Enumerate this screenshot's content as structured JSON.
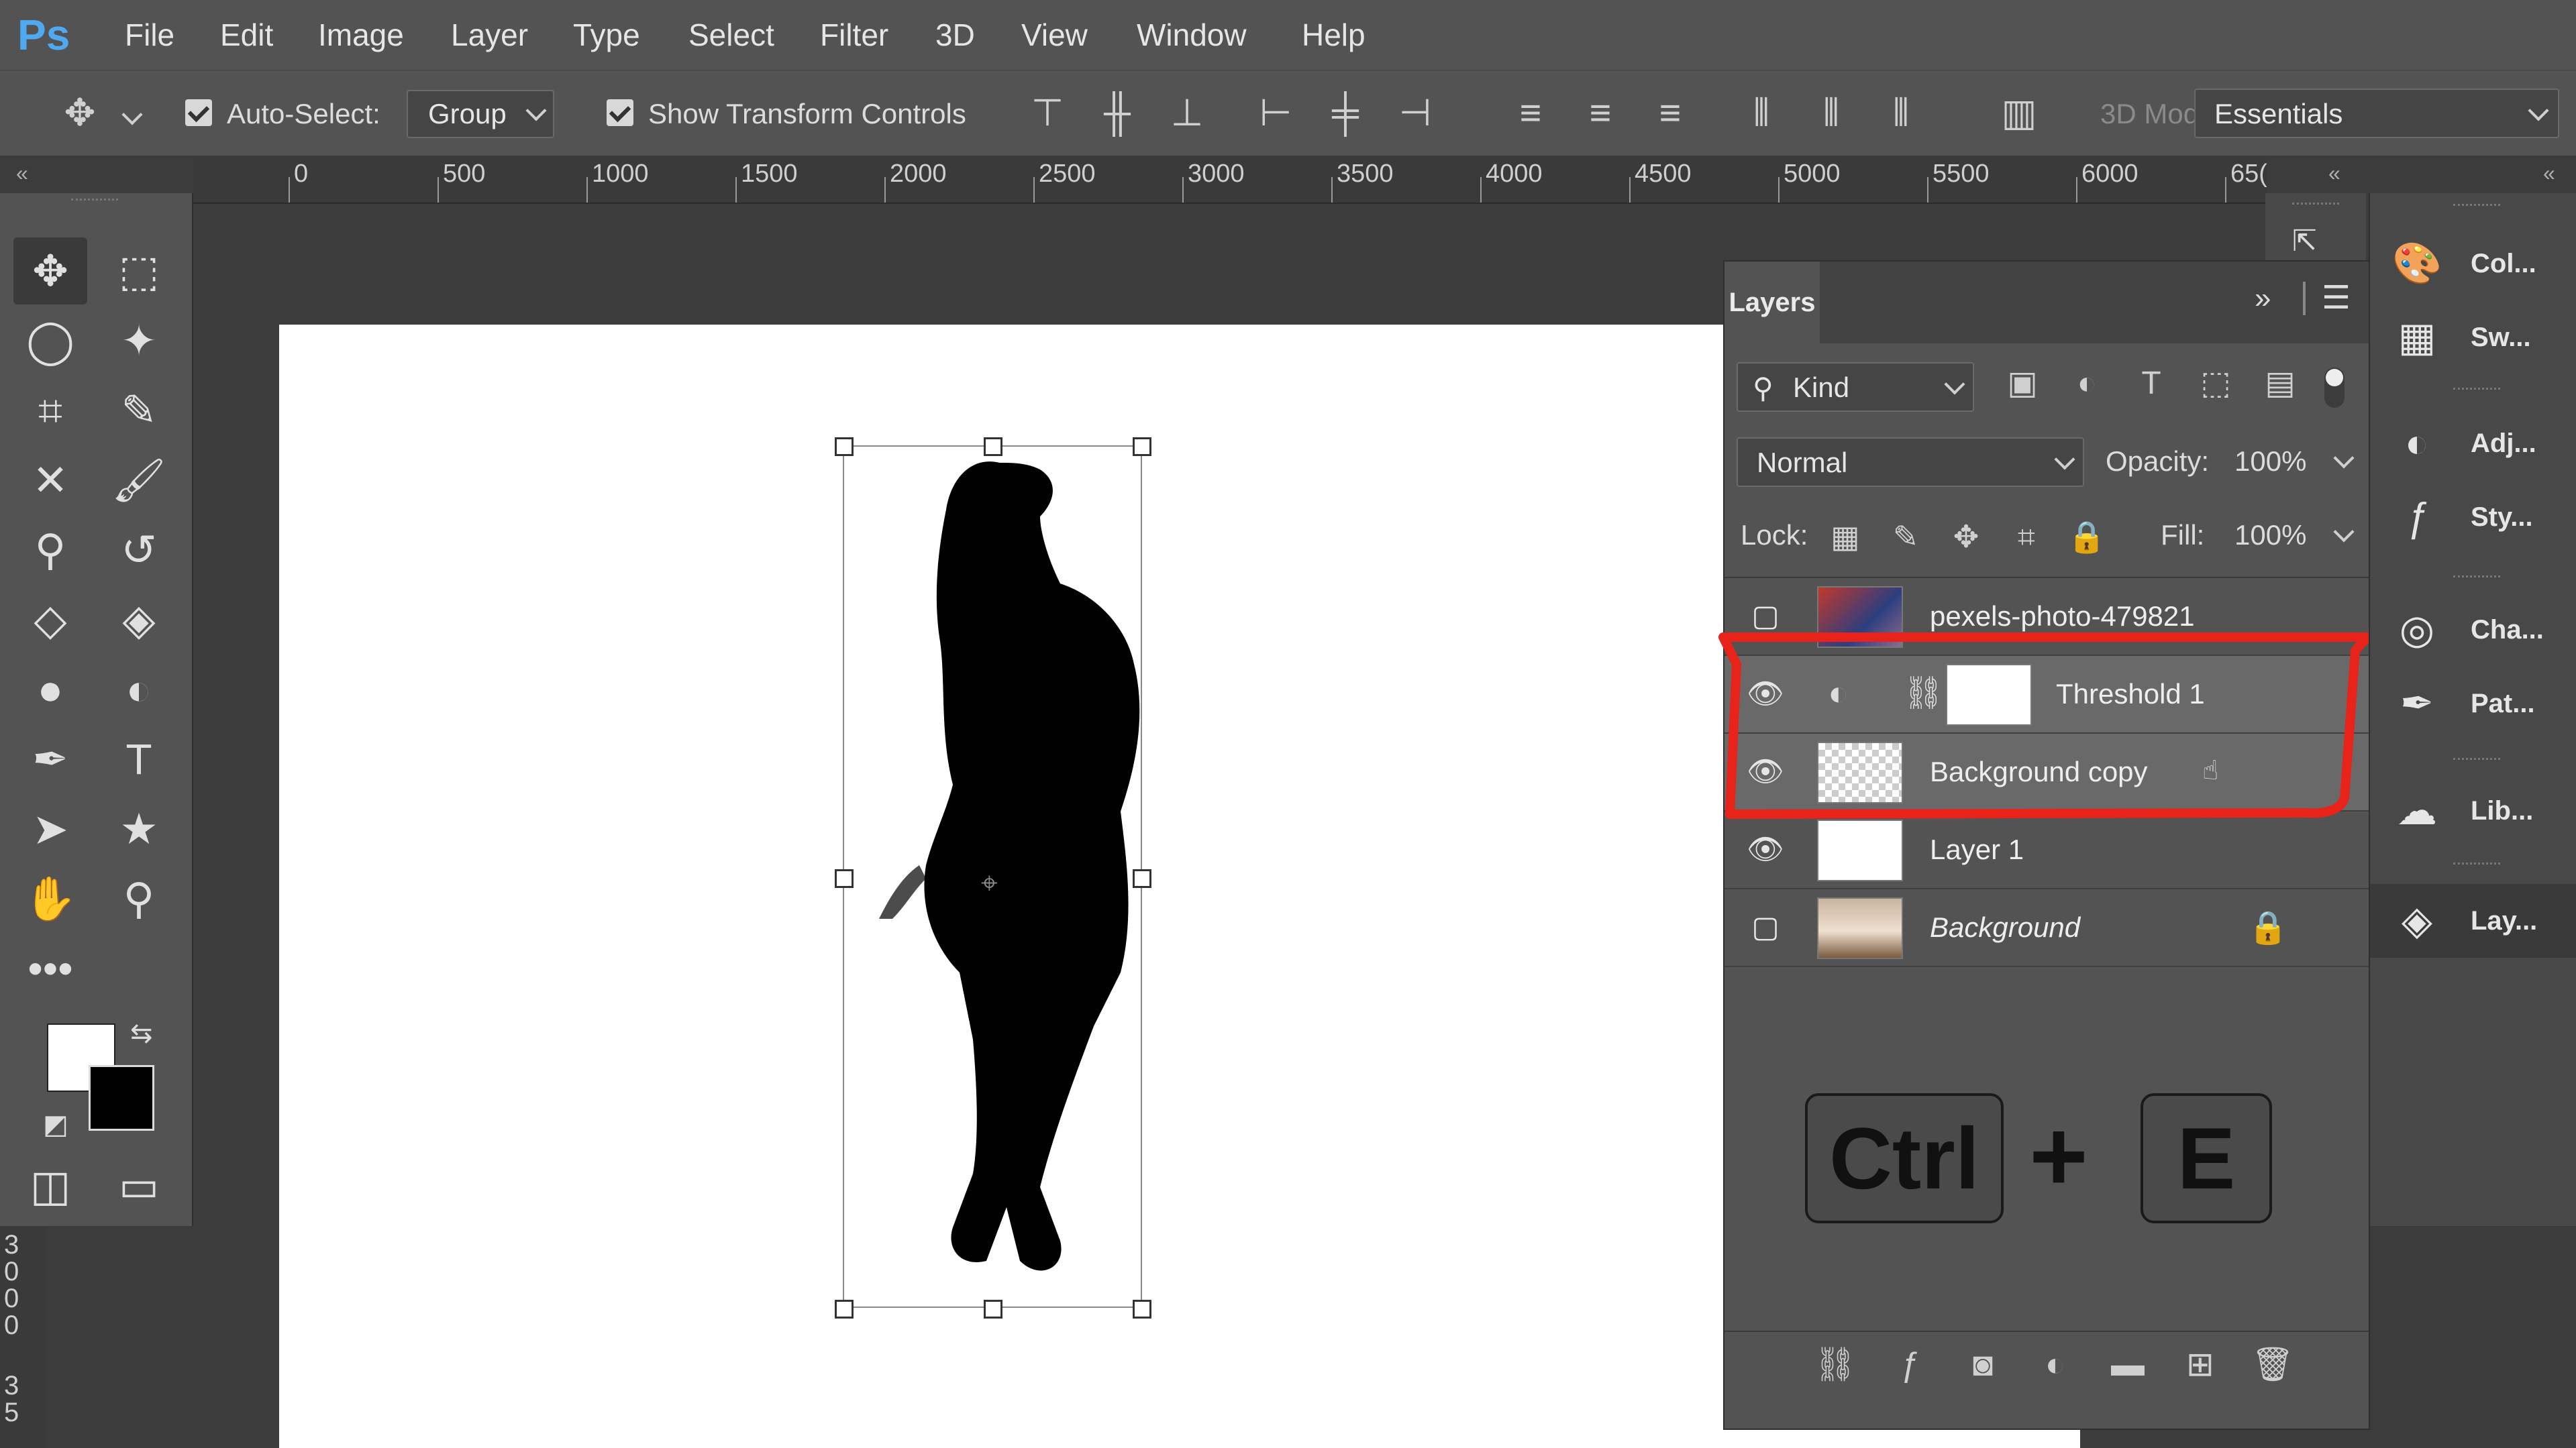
{
  "app": {
    "logo": "Ps"
  },
  "menu": {
    "items": [
      "File",
      "Edit",
      "Image",
      "Layer",
      "Type",
      "Select",
      "Filter",
      "3D",
      "View",
      "Window",
      "Help"
    ]
  },
  "options": {
    "auto_select_label": "Auto-Select:",
    "auto_select_checked": true,
    "auto_select_target": "Group",
    "show_transform_label": "Show Transform Controls",
    "show_transform_checked": true,
    "mode_label": "3D Mod",
    "workspace": "Essentials"
  },
  "ruler": {
    "labels": [
      "0",
      "500",
      "1000",
      "1500",
      "2000",
      "2500",
      "3000",
      "3500",
      "4000",
      "4500",
      "5000",
      "5500",
      "6000",
      "65("
    ]
  },
  "vruler": {
    "labels": [
      "3",
      "0",
      "0",
      "0",
      "3",
      "5"
    ]
  },
  "layers_panel": {
    "tab_label": "Layers",
    "filter_kind": "Kind",
    "blend_mode": "Normal",
    "opacity_label": "Opacity:",
    "opacity_value": "100%",
    "lock_label": "Lock:",
    "fill_label": "Fill:",
    "fill_value": "100%",
    "layers": [
      {
        "name": "pexels-photo-479821",
        "visible": false,
        "italic": false
      },
      {
        "name": "Threshold 1",
        "visible": true,
        "italic": false
      },
      {
        "name": "Background copy",
        "visible": true,
        "italic": false
      },
      {
        "name": "Layer 1",
        "visible": true,
        "italic": false
      },
      {
        "name": "Background",
        "visible": false,
        "italic": true
      }
    ]
  },
  "shortcut": {
    "key1": "Ctrl",
    "plus": "+",
    "key2": "E"
  },
  "dock": {
    "items": [
      "Col...",
      "Sw...",
      "Adj...",
      "Sty...",
      "Cha...",
      "Pat...",
      "Lib...",
      "Lay..."
    ]
  },
  "colors": {
    "highlight": "#e8231a",
    "foreground": "#ffffff",
    "background": "#000000",
    "accent": "#4fa9f0"
  }
}
